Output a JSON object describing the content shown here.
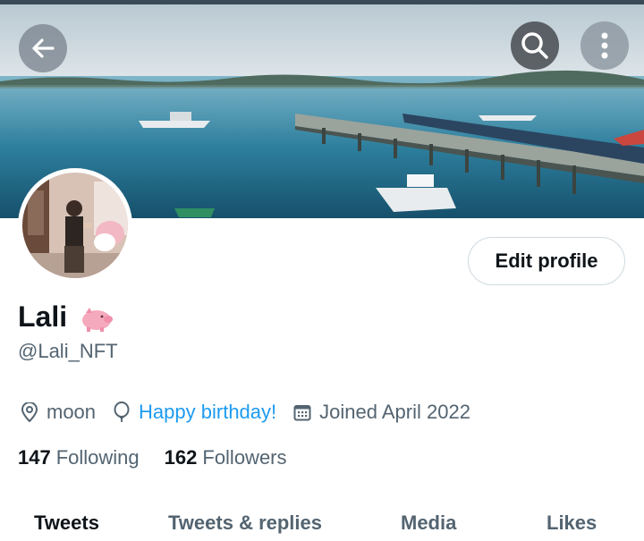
{
  "profile": {
    "name": "Lali",
    "handle": "@Lali_NFT",
    "location": "moon",
    "birthday_text": "Happy birthday!",
    "joined": "Joined April 2022",
    "following_count": "147",
    "following_label": "Following",
    "followers_count": "162",
    "followers_label": "Followers"
  },
  "actions": {
    "edit_profile": "Edit profile"
  },
  "tabs": [
    {
      "label": "Tweets",
      "active": true
    },
    {
      "label": "Tweets & replies",
      "active": false
    },
    {
      "label": "Media",
      "active": false
    },
    {
      "label": "Likes",
      "active": false
    }
  ],
  "icons": {
    "back": "arrow-left-icon",
    "search": "search-icon",
    "more": "more-vertical-icon",
    "location": "location-pin-icon",
    "birthday": "balloon-icon",
    "calendar": "calendar-icon",
    "pig": "pig-emoji-icon"
  },
  "colors": {
    "accent": "#1d9bf0",
    "text": "#0f1419",
    "muted": "#536471",
    "border": "#cfd9de"
  }
}
